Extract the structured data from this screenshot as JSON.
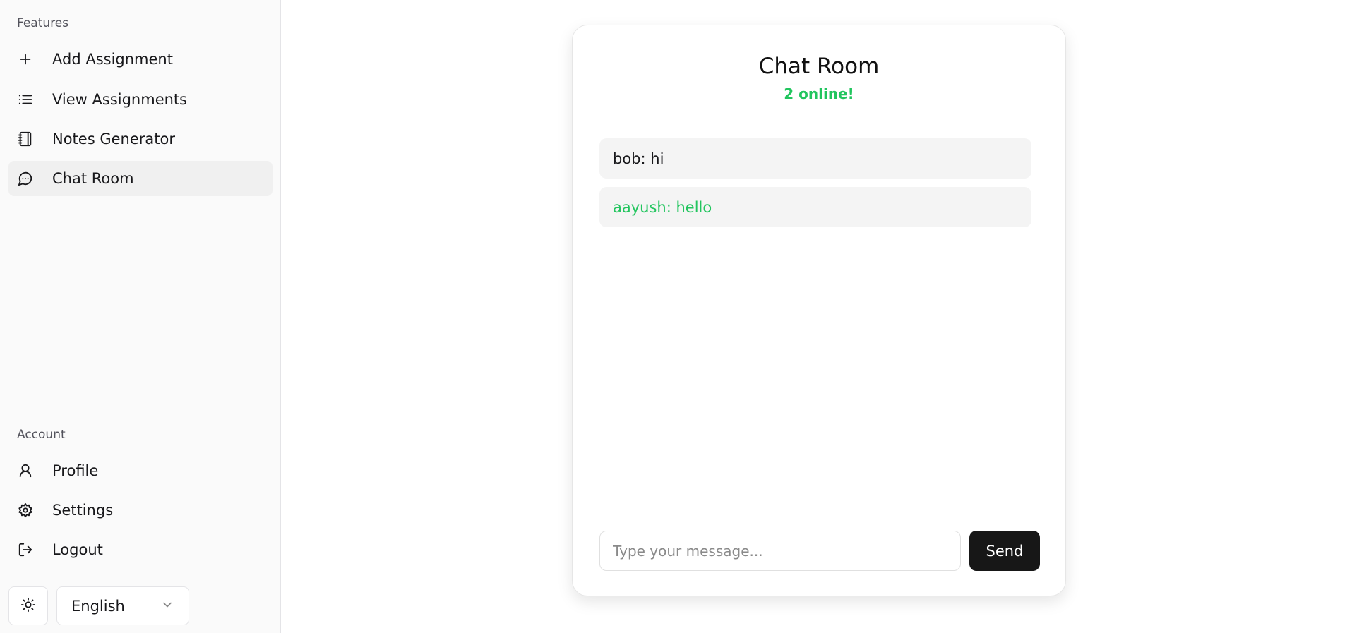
{
  "sidebar": {
    "features_label": "Features",
    "features": [
      {
        "label": "Add Assignment",
        "icon": "plus-icon"
      },
      {
        "label": "View Assignments",
        "icon": "list-icon"
      },
      {
        "label": "Notes Generator",
        "icon": "notebook-icon"
      },
      {
        "label": "Chat Room",
        "icon": "message-circle-icon",
        "active": true
      }
    ],
    "account_label": "Account",
    "account": [
      {
        "label": "Profile",
        "icon": "user-icon"
      },
      {
        "label": "Settings",
        "icon": "gear-icon"
      },
      {
        "label": "Logout",
        "icon": "logout-icon"
      }
    ],
    "theme_icon": "sun-icon",
    "language": {
      "selected": "English",
      "icon": "chevron-down-icon"
    }
  },
  "chat": {
    "title": "Chat Room",
    "online_status": "2 online!",
    "messages": [
      {
        "text": "bob: hi",
        "color": "#18181b"
      },
      {
        "text": "aayush: hello",
        "color": "#22c55e"
      }
    ],
    "input_placeholder": "Type your message...",
    "input_value": "",
    "send_label": "Send"
  },
  "colors": {
    "online": "#22c55e",
    "send_button": "#171717",
    "active_nav": "#f0f0f0",
    "sidebar_bg": "#fafafa"
  }
}
